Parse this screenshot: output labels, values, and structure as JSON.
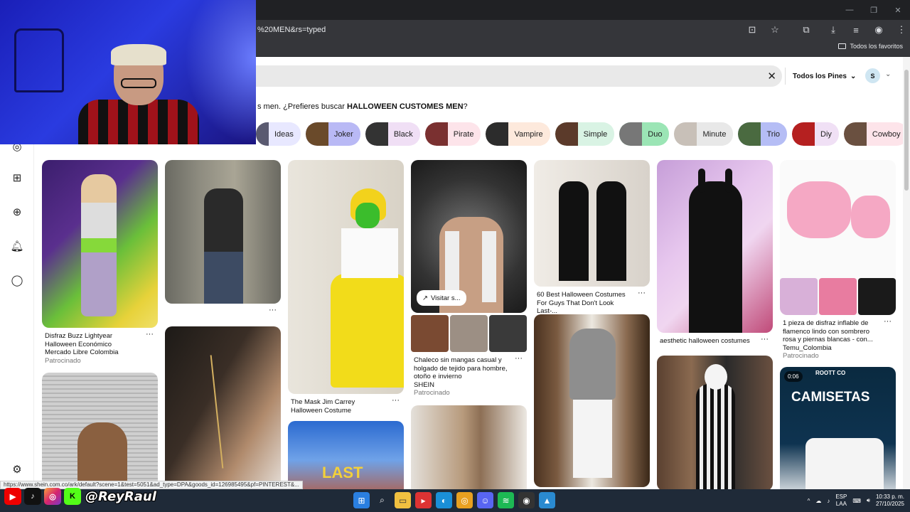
{
  "browser": {
    "url_fragment": "%20MEN&rs=typed",
    "bookmark_folder": "Todos los favoritos",
    "window_controls": [
      "—",
      "❐",
      "✕"
    ],
    "toolbar_icons": [
      "install-app-icon",
      "star-icon",
      "extensions-icon",
      "download-icon",
      "reading-list-icon",
      "profile-icon",
      "menu-icon"
    ]
  },
  "header": {
    "filter_label": "Todos los Pines",
    "avatar_initial": "S"
  },
  "suggestion": {
    "prefix": "s men. ¿Prefieres buscar ",
    "term": "HALLOWEEN CUSTOMES MEN",
    "suffix": "?"
  },
  "chips": [
    {
      "label": "Ideas",
      "bg": "#e8e8ff",
      "thumb": "#5a5a70"
    },
    {
      "label": "Joker",
      "bg": "#b9b9f5",
      "thumb": "#6a4a2a"
    },
    {
      "label": "Black",
      "bg": "#f0dff5",
      "thumb": "#333"
    },
    {
      "label": "Pirate",
      "bg": "#fde4ea",
      "thumb": "#7a3030"
    },
    {
      "label": "Vampire",
      "bg": "#fde9dc",
      "thumb": "#2c2c2c"
    },
    {
      "label": "Simple",
      "bg": "#d9f3e4",
      "thumb": "#5b3a2a"
    },
    {
      "label": "Duo",
      "bg": "#9be5b5",
      "thumb": "#777"
    },
    {
      "label": "Minute",
      "bg": "#e8e8e8",
      "thumb": "#c8c0b8"
    },
    {
      "label": "Trio",
      "bg": "#b5bdf5",
      "thumb": "#4a6a40"
    },
    {
      "label": "Diy",
      "bg": "#f0e0f5",
      "thumb": "#b52020"
    },
    {
      "label": "Cowboy",
      "bg": "#fde4ea",
      "thumb": "#6a5040"
    }
  ],
  "pins": {
    "p1": {
      "title": "Disfraz Buzz Lightyear Halloween Económico",
      "source": "Mercado Libre Colombia",
      "sponsored": "Patrocinado"
    },
    "p3": {
      "title": "The Mask Jim Carrey Halloween Costume"
    },
    "p4": {
      "title": "Chaleco sin mangas casual y holgado de tejido para hombre, otoño e invierno",
      "source": "SHEIN",
      "sponsored": "Patrocinado",
      "visit": "Visitar s..."
    },
    "p5": {
      "title": "60 Best Halloween Costumes For Guys That Don't Look Last-..."
    },
    "p6": {
      "title": "aesthetic halloween costumes"
    },
    "p7": {
      "title": "1 pieza de disfraz inflable de flamenco lindo con sombrero rosa y piernas blancas - con...",
      "source": "Temu_Colombia",
      "sponsored": "Patrocinado"
    },
    "p9_video_duration": "0:06",
    "p9_caption": "CAMISETAS",
    "p9_brand": "ROOTT CO"
  },
  "more_glyph": "···",
  "status_url": "https://www.shein.com.co/ark/default?scene=1&test=5051&ad_type=DPA&goods_id=126985495&pf=PINTEREST&...",
  "overlay": {
    "handle": "@ReyRaul"
  },
  "taskbar": {
    "lang_top": "ESP",
    "lang_bottom": "LAA",
    "time": "10:33 p. m.",
    "date": "27/10/2025"
  }
}
